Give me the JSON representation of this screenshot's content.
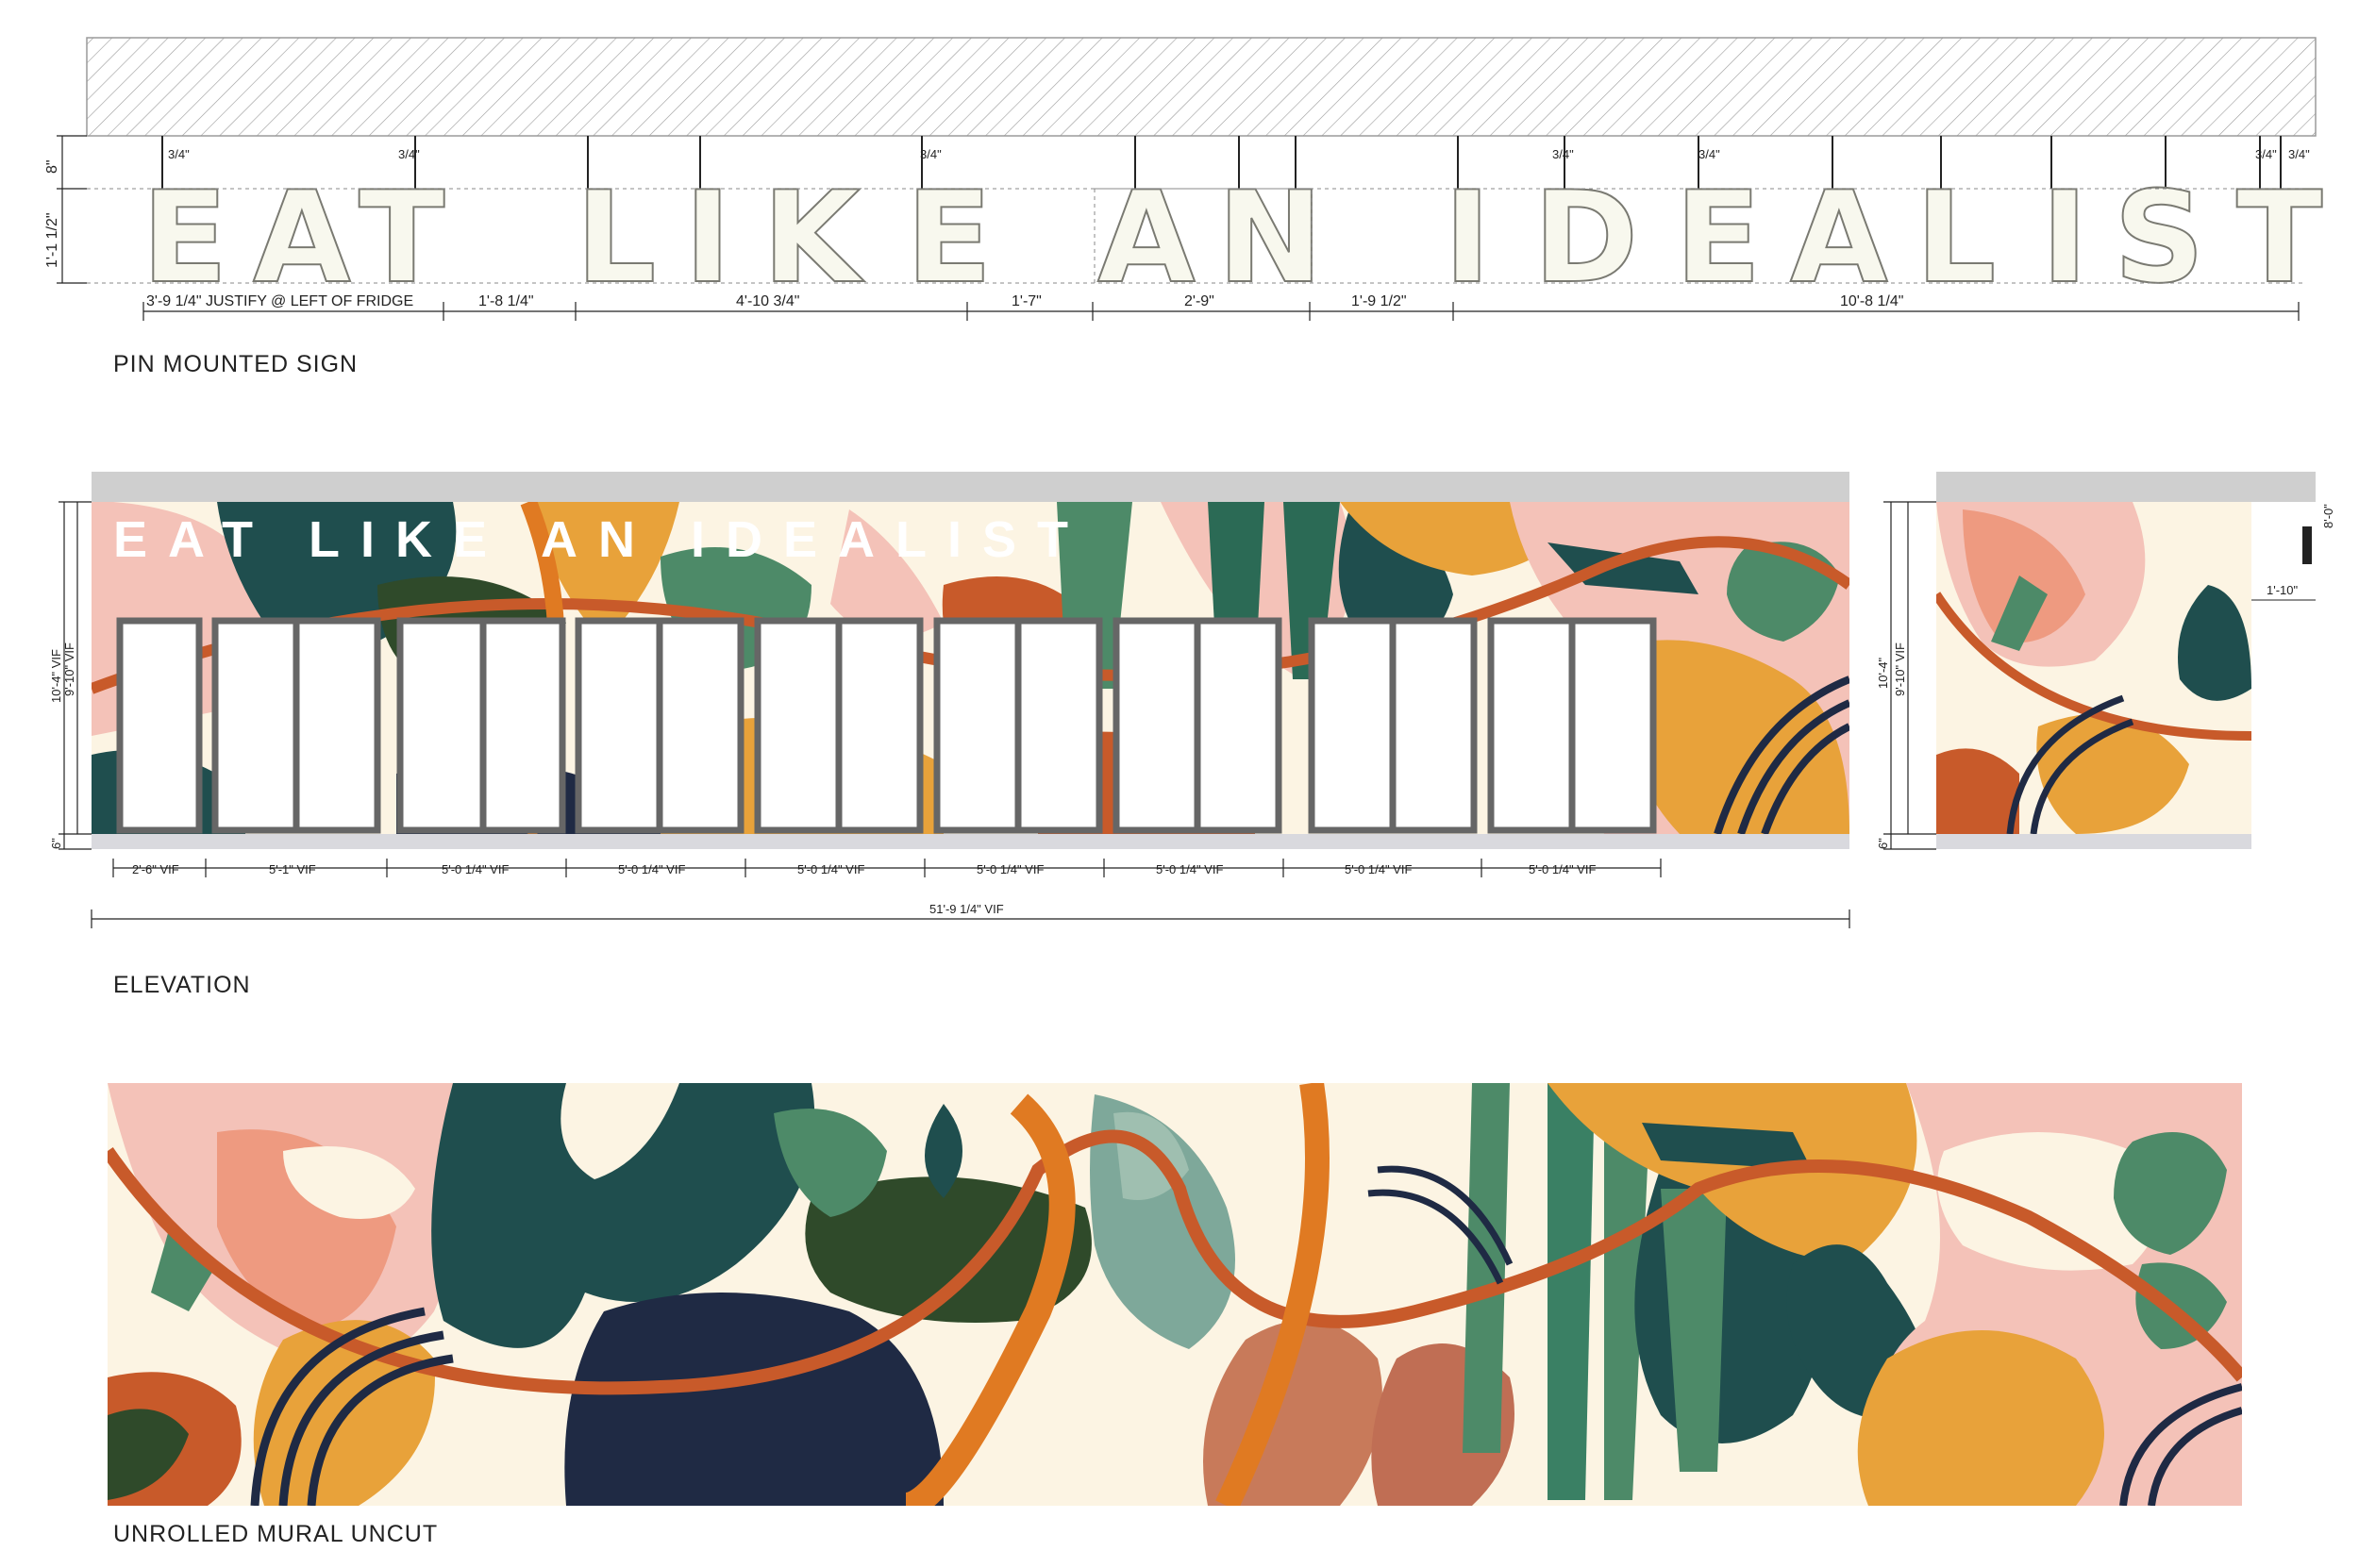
{
  "sections": {
    "sign_label": "PIN MOUNTED SIGN",
    "elevation_label": "ELEVATION",
    "mural_label": "UNROLLED MURAL UNCUT"
  },
  "sign": {
    "letters": [
      "E",
      "A",
      "T",
      "L",
      "I",
      "K",
      "E",
      "A",
      "N",
      "I",
      "D",
      "E",
      "A",
      "L",
      "I",
      "S",
      "T"
    ],
    "pin_offsets": [
      "3/4\"",
      "3/4\"",
      "3/4\"",
      "3/4\"",
      "3/4\"",
      "3/4\"",
      "3/4\""
    ],
    "vertical_dims": [
      "8\"",
      "1'-1 1/2\""
    ],
    "horizontal_dims": [
      "3'-9 1/4\" JUSTIFY @ LEFT OF FRIDGE",
      "1'-8 1/4\"",
      "4'-10 3/4\"",
      "1'-7\"",
      "2'-9\"",
      "1'-9 1/2\"",
      "10'-8 1/4\""
    ]
  },
  "elevation": {
    "sign_text": "EAT LIKE AN IDEALIST",
    "height_dims": [
      "10'-4\" VIF",
      "9'-10\" VIF",
      "6\""
    ],
    "side_height_dims": [
      "10'-4\"",
      "9'-10\" VIF",
      "6\""
    ],
    "side_dims": [
      "8'-0\"",
      "1'-10\""
    ],
    "bay_dims": [
      "2'-6\" VIF",
      "5'-1\" VIF",
      "5'-0 1/4\" VIF",
      "5'-0 1/4\" VIF",
      "5'-0 1/4\" VIF",
      "5'-0 1/4\" VIF",
      "5'-0 1/4\" VIF",
      "5'-0 1/4\" VIF",
      "5'-0 1/4\" VIF"
    ],
    "overall_dim": "51'-9 1/4\" VIF"
  },
  "colors": {
    "cream": "#fcf4e3",
    "pink": "#f4c2b8",
    "salmon": "#ee9a80",
    "orange": "#e8a23a",
    "burnt": "#c85a2a",
    "teal": "#1f4e4e",
    "green": "#4d8a68",
    "dark_green": "#2f4a2a",
    "navy": "#1f2a44",
    "ceiling": "#cfcfcf"
  }
}
